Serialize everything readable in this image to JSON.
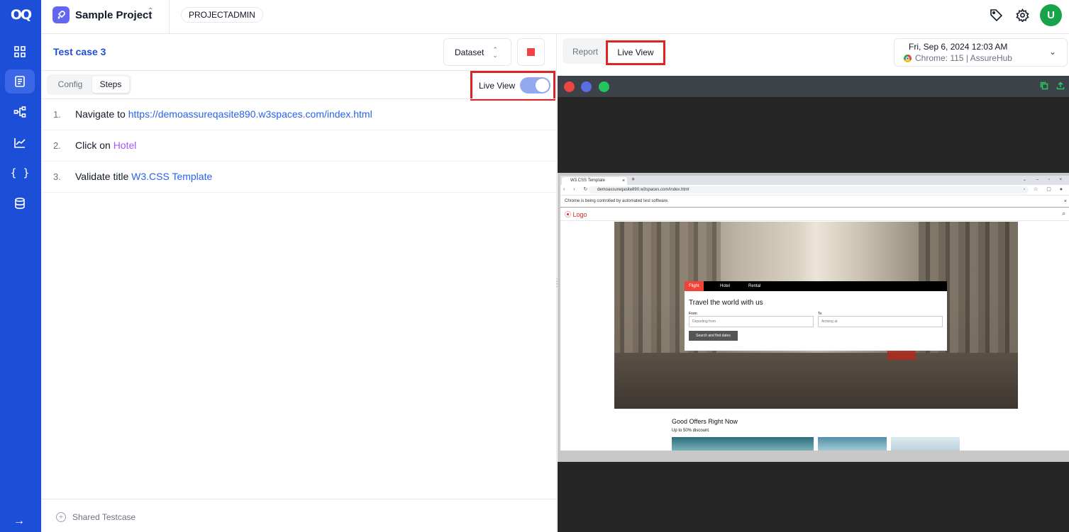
{
  "app": {
    "logo_text": "OQ"
  },
  "sidebar": {
    "items": [
      {
        "name": "dashboard",
        "icon": "grid-icon"
      },
      {
        "name": "testcases",
        "icon": "list-icon",
        "active": true
      },
      {
        "name": "flows",
        "icon": "workflow-icon"
      },
      {
        "name": "reports",
        "icon": "chart-icon"
      },
      {
        "name": "variables",
        "icon": "braces-icon",
        "glyph": "{ }"
      },
      {
        "name": "data",
        "icon": "database-icon"
      }
    ],
    "expand_glyph": "→"
  },
  "header": {
    "project_name": "Sample Project",
    "role": "PROJECTADMIN",
    "avatar_initial": "U",
    "avatar_color": "#16a34a",
    "accent": "#1d4ed8"
  },
  "testcase": {
    "title": "Test case 3",
    "dataset_label": "Dataset",
    "tabs": {
      "config": "Config",
      "steps": "Steps"
    },
    "live_view_label": "Live View",
    "live_view_on": true,
    "steps": [
      {
        "num": "1.",
        "action": "Navigate to",
        "target": "https://demoassureqasite890.w3spaces.com/index.html",
        "kind": "link"
      },
      {
        "num": "2.",
        "action": "Click on",
        "target": "Hotel",
        "kind": "element"
      },
      {
        "num": "3.",
        "action": "Validate title",
        "target": "W3.CSS Template",
        "kind": "link"
      }
    ],
    "shared_label": "Shared Testcase"
  },
  "run": {
    "tabs": {
      "report": "Report",
      "live": "Live View"
    },
    "date": "Fri, Sep 6, 2024 12:03 AM",
    "browser": "Chrome: 115 | AssureHub"
  },
  "viewer": {
    "dots": [
      "#ef4444",
      "#5b6ee1",
      "#22c55e"
    ],
    "tab_title": "W3.CSS Template",
    "url": "demoassureqasite890.w3spaces.com/index.html",
    "infobar": "Chrome is being controlled by automated test software.",
    "site": {
      "logo": "Logo",
      "form_tabs": [
        "Flight",
        "Hotel",
        "Rental"
      ],
      "form_title": "Travel the world with us",
      "from_label": "From",
      "to_label": "To",
      "from_placeholder": "Departing from",
      "to_placeholder": "Arriving at",
      "search_button": "Search and find dates",
      "offers_title": "Good Offers Right Now",
      "offers_sub": "Up to 50% discount."
    }
  }
}
